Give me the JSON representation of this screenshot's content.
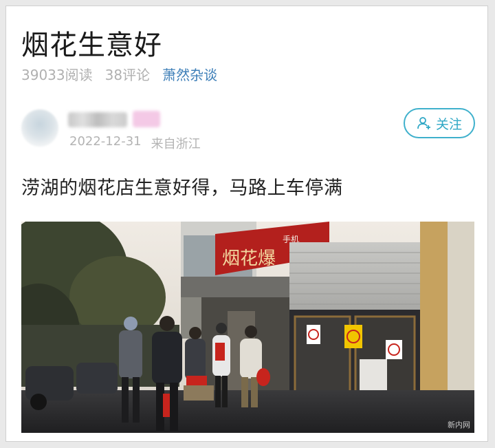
{
  "article": {
    "title": "烟花生意好",
    "reads": "39033阅读",
    "comments": "38评论",
    "source": "萧然杂谈",
    "author": {
      "date": "2022-12-31",
      "location": "来自浙江"
    },
    "follow_label": "关注",
    "body": "涝湖的烟花店生意好得，马路上车停满",
    "photo": {
      "store_sign": "烟花爆",
      "sign_sub": "手机",
      "watermark": "新内网"
    }
  },
  "colors": {
    "accent": "#2ea7c5",
    "source_link": "#3e7fb8",
    "meta_gray": "#b0b0b0"
  }
}
